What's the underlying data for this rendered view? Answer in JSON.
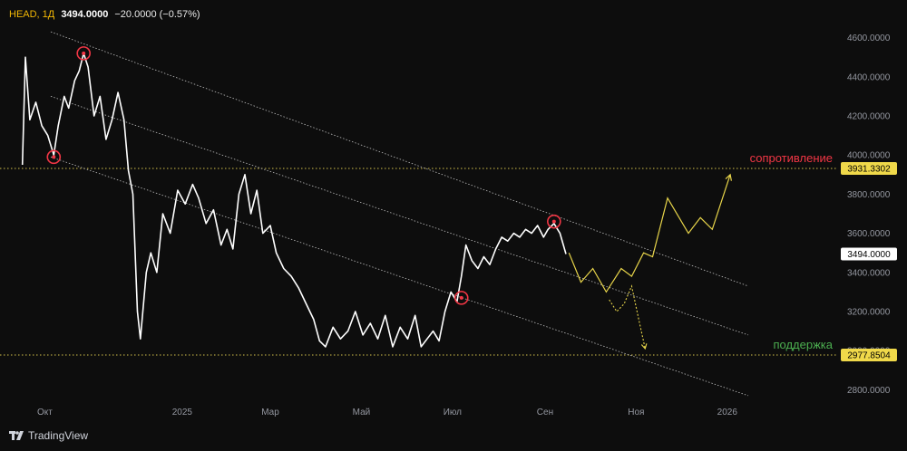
{
  "legend": {
    "symbol": "HEAD, 1Д",
    "last": "3494.0000",
    "change": "−20.0000 (−0.57%)"
  },
  "brand": {
    "name": "TradingView",
    "icon": "tradingview-logo-icon"
  },
  "colors": {
    "background": "#0d0d0d",
    "price_line": "#ffffff",
    "forecast": "#e8d54a",
    "level_line": "#d4c14a",
    "channel": "#bfbfbf",
    "resistance_text": "#f23645",
    "support_text": "#4caf50",
    "marker": "#f23645"
  },
  "chart_data": {
    "type": "line",
    "y_axis": {
      "ylim": [
        2700,
        4700
      ],
      "ticks": [
        2800,
        3000,
        3200,
        3400,
        3600,
        3800,
        4000,
        4200,
        4400,
        4600
      ],
      "tick_labels": [
        "2800.0000",
        "3000.0000",
        "3200.0000",
        "3400.0000",
        "3600.0000",
        "3800.0000",
        "4000.0000",
        "4200.0000",
        "4400.0000",
        "4600.0000"
      ],
      "side": "right"
    },
    "x_axis": {
      "xlim": [
        "2024-09-01",
        "2026-03-15"
      ],
      "ticks": [
        "2024-10-01",
        "2025-01-01",
        "2025-03-01",
        "2025-05-01",
        "2025-07-01",
        "2025-09-01",
        "2025-11-01",
        "2026-01-01"
      ],
      "tick_labels": [
        "Окт",
        "2025",
        "Мар",
        "Май",
        "Июл",
        "Сен",
        "Ноя",
        "2026"
      ]
    },
    "grid": false,
    "series": [
      {
        "kind": "price",
        "points": [
          [
            "2024-09-16",
            3950
          ],
          [
            "2024-09-18",
            4500
          ],
          [
            "2024-09-21",
            4180
          ],
          [
            "2024-09-25",
            4270
          ],
          [
            "2024-09-29",
            4150
          ],
          [
            "2024-10-03",
            4100
          ],
          [
            "2024-10-07",
            4000
          ],
          [
            "2024-10-10",
            4150
          ],
          [
            "2024-10-14",
            4300
          ],
          [
            "2024-10-17",
            4240
          ],
          [
            "2024-10-21",
            4380
          ],
          [
            "2024-10-24",
            4430
          ],
          [
            "2024-10-27",
            4520
          ],
          [
            "2024-10-30",
            4450
          ],
          [
            "2024-11-03",
            4200
          ],
          [
            "2024-11-07",
            4300
          ],
          [
            "2024-11-11",
            4080
          ],
          [
            "2024-11-15",
            4180
          ],
          [
            "2024-11-19",
            4320
          ],
          [
            "2024-11-23",
            4180
          ],
          [
            "2024-11-26",
            3920
          ],
          [
            "2024-11-29",
            3800
          ],
          [
            "2024-12-02",
            3200
          ],
          [
            "2024-12-04",
            3060
          ],
          [
            "2024-12-08",
            3400
          ],
          [
            "2024-12-11",
            3500
          ],
          [
            "2024-12-15",
            3400
          ],
          [
            "2024-12-19",
            3700
          ],
          [
            "2024-12-24",
            3600
          ],
          [
            "2024-12-29",
            3820
          ],
          [
            "2025-01-03",
            3750
          ],
          [
            "2025-01-08",
            3850
          ],
          [
            "2025-01-12",
            3780
          ],
          [
            "2025-01-17",
            3650
          ],
          [
            "2025-01-22",
            3720
          ],
          [
            "2025-01-27",
            3540
          ],
          [
            "2025-01-31",
            3620
          ],
          [
            "2025-02-04",
            3520
          ],
          [
            "2025-02-08",
            3800
          ],
          [
            "2025-02-12",
            3900
          ],
          [
            "2025-02-16",
            3700
          ],
          [
            "2025-02-20",
            3820
          ],
          [
            "2025-02-24",
            3600
          ],
          [
            "2025-03-01",
            3640
          ],
          [
            "2025-03-05",
            3500
          ],
          [
            "2025-03-10",
            3420
          ],
          [
            "2025-03-15",
            3380
          ],
          [
            "2025-03-20",
            3320
          ],
          [
            "2025-03-25",
            3240
          ],
          [
            "2025-03-30",
            3160
          ],
          [
            "2025-04-03",
            3050
          ],
          [
            "2025-04-07",
            3020
          ],
          [
            "2025-04-12",
            3120
          ],
          [
            "2025-04-17",
            3060
          ],
          [
            "2025-04-22",
            3100
          ],
          [
            "2025-04-27",
            3200
          ],
          [
            "2025-05-02",
            3080
          ],
          [
            "2025-05-07",
            3140
          ],
          [
            "2025-05-12",
            3060
          ],
          [
            "2025-05-17",
            3180
          ],
          [
            "2025-05-22",
            3020
          ],
          [
            "2025-05-27",
            3120
          ],
          [
            "2025-06-01",
            3060
          ],
          [
            "2025-06-06",
            3180
          ],
          [
            "2025-06-10",
            3020
          ],
          [
            "2025-06-14",
            3060
          ],
          [
            "2025-06-18",
            3100
          ],
          [
            "2025-06-22",
            3050
          ],
          [
            "2025-06-26",
            3200
          ],
          [
            "2025-06-30",
            3300
          ],
          [
            "2025-07-04",
            3250
          ],
          [
            "2025-07-07",
            3380
          ],
          [
            "2025-07-10",
            3540
          ],
          [
            "2025-07-14",
            3460
          ],
          [
            "2025-07-18",
            3420
          ],
          [
            "2025-07-22",
            3480
          ],
          [
            "2025-07-26",
            3440
          ],
          [
            "2025-07-30",
            3520
          ],
          [
            "2025-08-03",
            3580
          ],
          [
            "2025-08-07",
            3560
          ],
          [
            "2025-08-11",
            3600
          ],
          [
            "2025-08-15",
            3580
          ],
          [
            "2025-08-19",
            3620
          ],
          [
            "2025-08-23",
            3600
          ],
          [
            "2025-08-27",
            3640
          ],
          [
            "2025-08-31",
            3580
          ],
          [
            "2025-09-03",
            3620
          ],
          [
            "2025-09-07",
            3650
          ],
          [
            "2025-09-11",
            3600
          ],
          [
            "2025-09-15",
            3494
          ]
        ]
      },
      {
        "kind": "forecast-main",
        "points": [
          [
            "2025-09-17",
            3500
          ],
          [
            "2025-09-25",
            3350
          ],
          [
            "2025-10-03",
            3420
          ],
          [
            "2025-10-12",
            3300
          ],
          [
            "2025-10-22",
            3420
          ],
          [
            "2025-10-29",
            3380
          ],
          [
            "2025-11-06",
            3500
          ],
          [
            "2025-11-12",
            3480
          ],
          [
            "2025-11-22",
            3780
          ],
          [
            "2025-12-06",
            3600
          ],
          [
            "2025-12-14",
            3680
          ],
          [
            "2025-12-22",
            3620
          ],
          [
            "2026-01-03",
            3900
          ]
        ]
      },
      {
        "kind": "forecast-alt",
        "points": [
          [
            "2025-10-14",
            3260
          ],
          [
            "2025-10-19",
            3200
          ],
          [
            "2025-10-24",
            3240
          ],
          [
            "2025-10-29",
            3330
          ],
          [
            "2025-11-03",
            3150
          ],
          [
            "2025-11-07",
            3010
          ]
        ]
      }
    ],
    "channel_lines": [
      {
        "from": [
          "2024-10-05",
          4630
        ],
        "to": [
          "2026-01-15",
          3330
        ]
      },
      {
        "from": [
          "2024-10-05",
          4300
        ],
        "to": [
          "2026-01-15",
          3080
        ]
      },
      {
        "from": [
          "2024-10-05",
          3990
        ],
        "to": [
          "2026-01-15",
          2770
        ]
      }
    ],
    "levels": [
      {
        "value": 3931.3302,
        "label": "3931.3302",
        "annotation": "сопротивление",
        "annotation_role": "resistance"
      },
      {
        "value": 2977.8504,
        "label": "2977.8504",
        "annotation": "поддержка",
        "annotation_role": "support"
      }
    ],
    "last_price_tag": {
      "value": 3494.0,
      "label": "3494.0000"
    },
    "markers": [
      {
        "date": "2024-10-07",
        "value": 3990
      },
      {
        "date": "2024-10-27",
        "value": 4520
      },
      {
        "date": "2025-07-07",
        "value": 3270
      },
      {
        "date": "2025-09-07",
        "value": 3660
      }
    ]
  }
}
